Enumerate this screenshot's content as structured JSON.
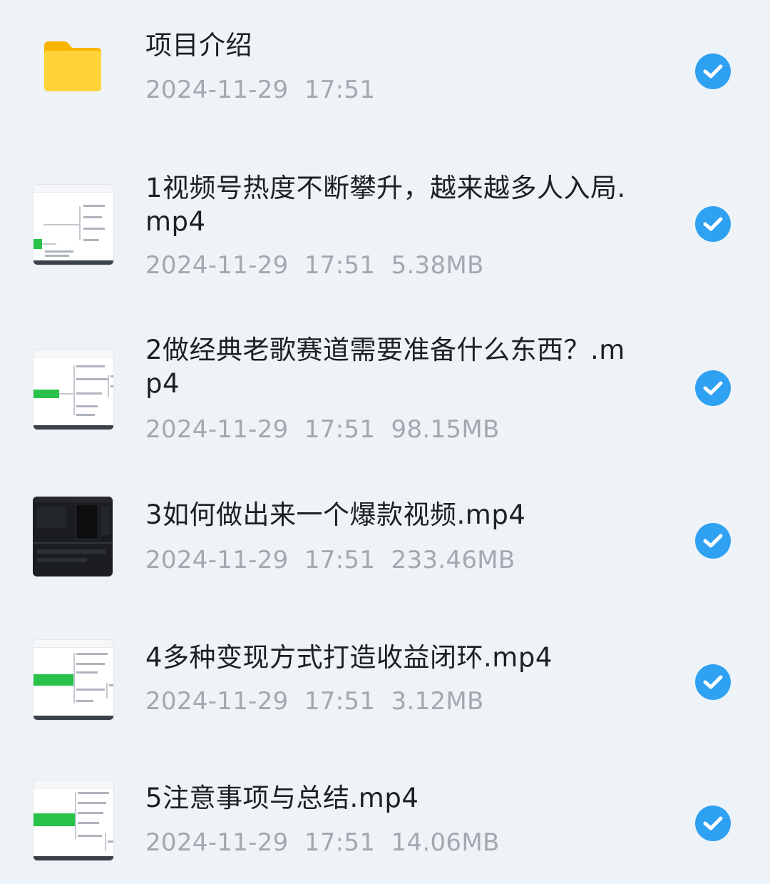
{
  "files": [
    {
      "name": "项目介绍",
      "date": "2024-11-29",
      "time": "17:51",
      "size": "",
      "type": "folder",
      "thumbnail": "folder-icon",
      "selected": true
    },
    {
      "name": "1视频号热度不断攀升，越来越多人入局.mp4",
      "date": "2024-11-29",
      "time": "17:51",
      "size": "5.38MB",
      "type": "video",
      "thumbnail": "mindmap-thumbnail",
      "selected": true
    },
    {
      "name": "2做经典老歌赛道需要准备什么东西？.mp4",
      "date": "2024-11-29",
      "time": "17:51",
      "size": "98.15MB",
      "type": "video",
      "thumbnail": "mindmap-thumbnail",
      "selected": true
    },
    {
      "name": "3如何做出来一个爆款视频.mp4",
      "date": "2024-11-29",
      "time": "17:51",
      "size": "233.46MB",
      "type": "video",
      "thumbnail": "video-editor-thumbnail",
      "selected": true
    },
    {
      "name": "4多种变现方式打造收益闭环.mp4",
      "date": "2024-11-29",
      "time": "17:51",
      "size": "3.12MB",
      "type": "video",
      "thumbnail": "mindmap-thumbnail",
      "selected": true
    },
    {
      "name": "5注意事项与总结.mp4",
      "date": "2024-11-29",
      "time": "17:51",
      "size": "14.06MB",
      "type": "video",
      "thumbnail": "mindmap-thumbnail",
      "selected": true
    }
  ],
  "colors": {
    "background": "#eef3f8",
    "check_accent": "#2ea1f2",
    "folder": "#fcc419",
    "meta_text": "#a3a8b0",
    "title_text": "#1d1f24"
  },
  "icons": {
    "checked": "checkmark-circle-icon",
    "folder": "folder-icon"
  }
}
